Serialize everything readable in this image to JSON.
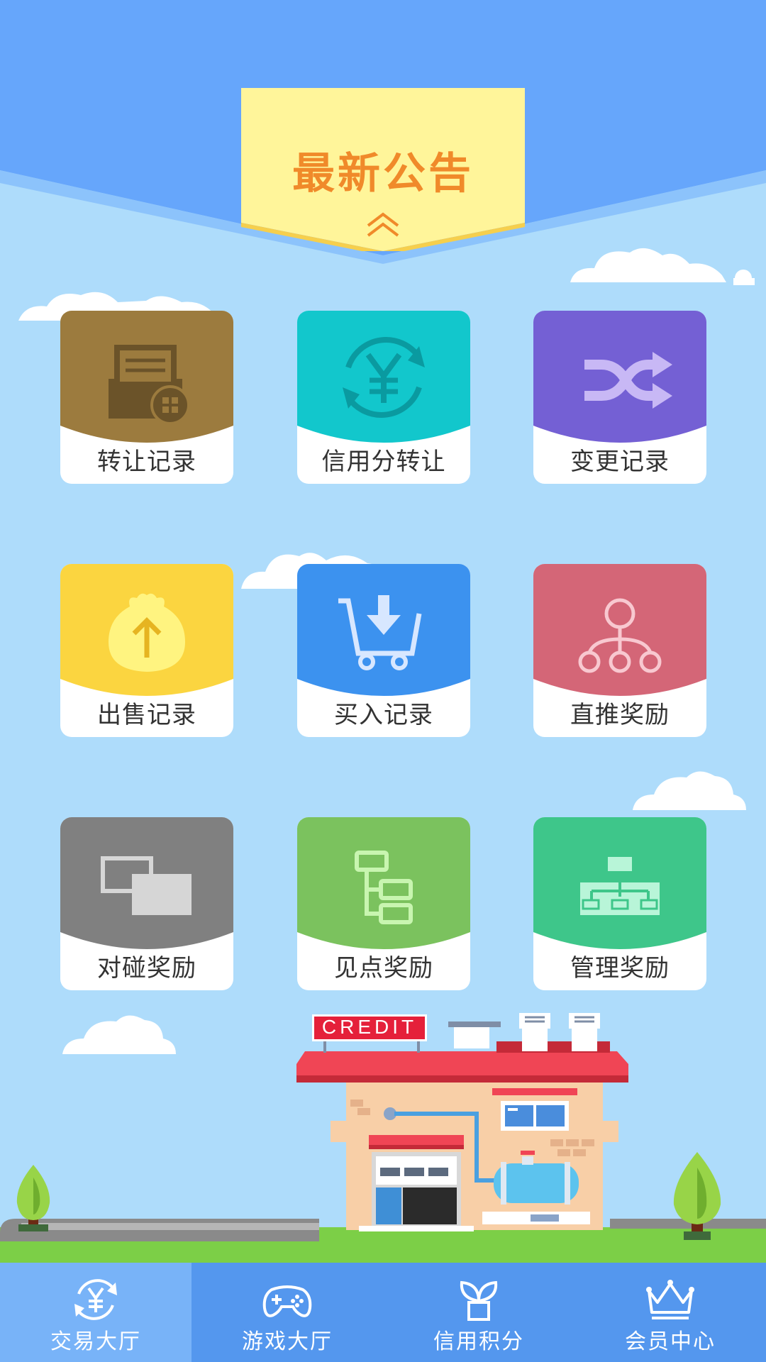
{
  "notice": {
    "title": "最新公告",
    "expand_icon": "double-chevron-up-icon"
  },
  "grid": [
    {
      "label": "转让记录",
      "icon": "transfer-record-icon",
      "color": "#9c7b3e"
    },
    {
      "label": "信用分转让",
      "icon": "yen-exchange-icon",
      "color": "#12c7cc"
    },
    {
      "label": "变更记录",
      "icon": "shuffle-icon",
      "color": "#7460d4"
    },
    {
      "label": "出售记录",
      "icon": "money-bag-icon",
      "color": "#fbd540"
    },
    {
      "label": "买入记录",
      "icon": "cart-download-icon",
      "color": "#3c92ef"
    },
    {
      "label": "直推奖励",
      "icon": "hierarchy-nodes-icon",
      "color": "#d46677"
    },
    {
      "label": "对碰奖励",
      "icon": "overlap-squares-icon",
      "color": "#808080"
    },
    {
      "label": "见点奖励",
      "icon": "tree-list-icon",
      "color": "#7bc25e"
    },
    {
      "label": "管理奖励",
      "icon": "org-chart-icon",
      "color": "#3ec68a"
    }
  ],
  "illustration": {
    "sign_text": "CREDIT"
  },
  "nav": [
    {
      "label": "交易大厅",
      "icon": "yen-cycle-icon",
      "active": true
    },
    {
      "label": "游戏大厅",
      "icon": "gamepad-icon",
      "active": false
    },
    {
      "label": "信用积分",
      "icon": "sprout-pot-icon",
      "active": false
    },
    {
      "label": "会员中心",
      "icon": "crown-icon",
      "active": false
    }
  ]
}
